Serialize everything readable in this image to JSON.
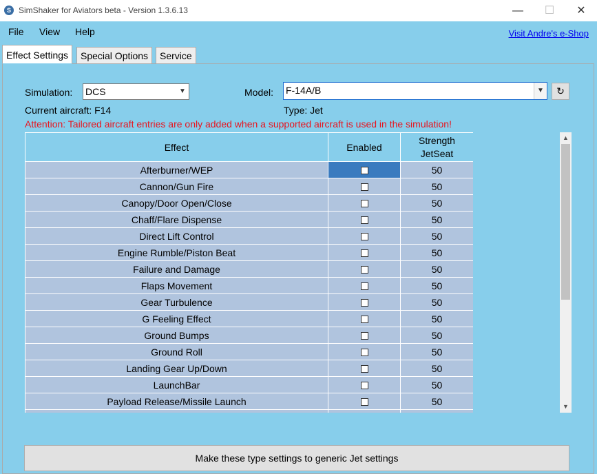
{
  "window": {
    "title": "SimShaker for Aviators beta  - Version 1.3.6.13",
    "minimize": "—",
    "maximize": "☐",
    "close": "✕"
  },
  "menu": {
    "items": [
      "File",
      "View",
      "Help"
    ],
    "shop_link": "Visit Andre's e-Shop"
  },
  "tabs": [
    "Effect Settings",
    "Special Options",
    "Service"
  ],
  "settings": {
    "simulation_label": "Simulation:",
    "simulation_value": "DCS",
    "model_label": "Model:",
    "model_value": "F-14A/B",
    "current_aircraft": "Current aircraft: F14",
    "type": "Type: Jet",
    "attention": "Attention: Tailored aircraft entries are only added when a supported aircraft is used in the simulation!",
    "refresh_icon": "↻"
  },
  "table": {
    "headers": [
      "Effect",
      "Enabled",
      "Strength\nJetSeat"
    ],
    "rows": [
      {
        "effect": "Afterburner/WEP",
        "enabled": false,
        "strength": "50"
      },
      {
        "effect": "Cannon/Gun Fire",
        "enabled": false,
        "strength": "50"
      },
      {
        "effect": "Canopy/Door Open/Close",
        "enabled": false,
        "strength": "50"
      },
      {
        "effect": "Chaff/Flare Dispense",
        "enabled": false,
        "strength": "50"
      },
      {
        "effect": "Direct Lift Control",
        "enabled": false,
        "strength": "50"
      },
      {
        "effect": "Engine Rumble/Piston Beat",
        "enabled": false,
        "strength": "50"
      },
      {
        "effect": "Failure and Damage",
        "enabled": false,
        "strength": "50"
      },
      {
        "effect": "Flaps Movement",
        "enabled": false,
        "strength": "50"
      },
      {
        "effect": "Gear Turbulence",
        "enabled": false,
        "strength": "50"
      },
      {
        "effect": "G Feeling Effect",
        "enabled": false,
        "strength": "50"
      },
      {
        "effect": "Ground Bumps",
        "enabled": false,
        "strength": "50"
      },
      {
        "effect": "Ground Roll",
        "enabled": false,
        "strength": "50"
      },
      {
        "effect": "Landing Gear Up/Down",
        "enabled": false,
        "strength": "50"
      },
      {
        "effect": "LaunchBar",
        "enabled": false,
        "strength": "50"
      },
      {
        "effect": "Payload Release/Missile Launch",
        "enabled": false,
        "strength": "50"
      },
      {
        "effect": "",
        "enabled": false,
        "strength": ""
      }
    ]
  },
  "generic_button": "Make these type settings to generic Jet settings",
  "colors": {
    "background": "#87ceeb",
    "row": "#b0c4de",
    "selected_cell": "#3a7bbf",
    "attention": "#e8141e"
  }
}
